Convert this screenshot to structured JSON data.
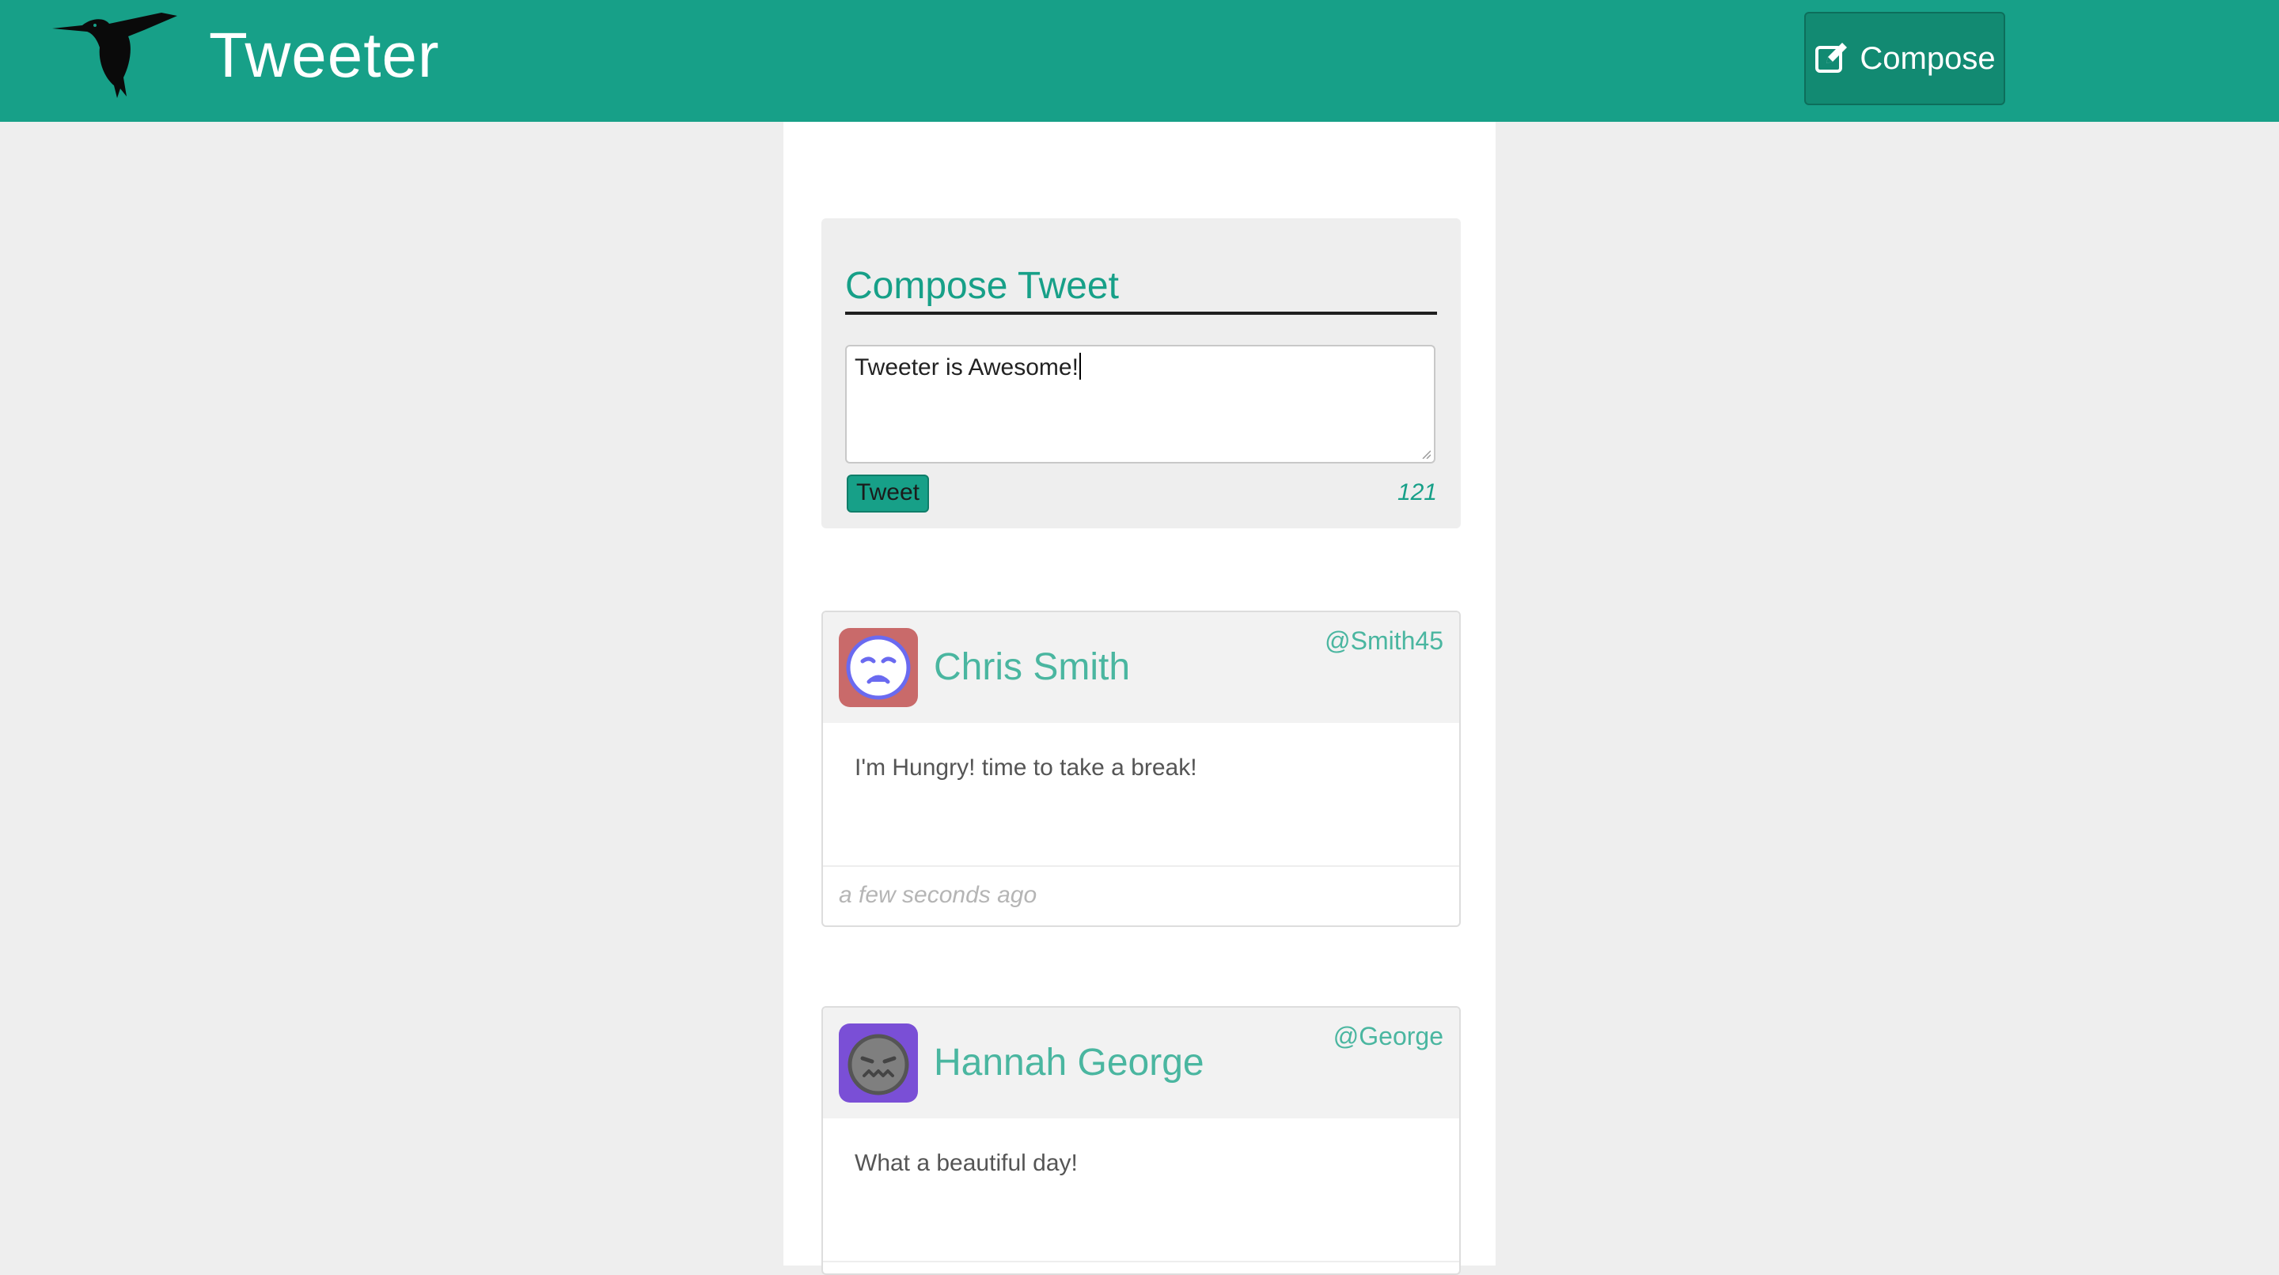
{
  "navbar": {
    "brand": "Tweeter",
    "compose_label": "Compose",
    "bg_color": "#17a088"
  },
  "compose": {
    "title": "Compose Tweet",
    "text": "Tweeter is Awesome!",
    "button_label": "Tweet",
    "counter": "121"
  },
  "tweets": [
    {
      "name": "Chris Smith",
      "handle": "@Smith45",
      "text": "I'm Hungry! time to take a break!",
      "time": "a few seconds ago",
      "avatar_icon": "sleepy-face-icon",
      "avatar_color": "#c96a6a"
    },
    {
      "name": "Hannah George",
      "handle": "@George",
      "text": "What a beautiful day!",
      "time": "",
      "avatar_icon": "grimace-face-icon",
      "avatar_color": "#7a4fd6"
    }
  ]
}
